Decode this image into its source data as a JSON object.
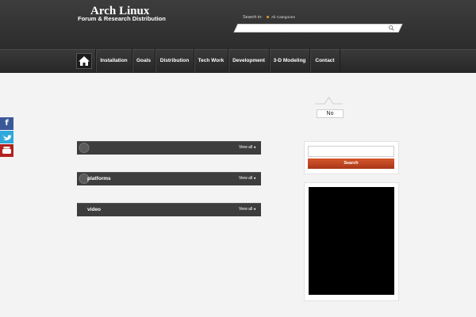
{
  "brand": {
    "title": "Arch Linux",
    "subtitle": "Forum & Research Distribution"
  },
  "search": {
    "label": "Search in:",
    "category": "All Categories",
    "placeholder": "",
    "value": ""
  },
  "nav": {
    "items": [
      {
        "label": "Installation"
      },
      {
        "label": "Goals"
      },
      {
        "label": "Distribution"
      },
      {
        "label": "Tech Work"
      },
      {
        "label": "Development"
      },
      {
        "label": "3-D Modeling"
      },
      {
        "label": "Contact"
      }
    ]
  },
  "dropdown": {
    "text": "No"
  },
  "sections": [
    {
      "title": "",
      "view_all": "View all"
    },
    {
      "title": "platforms",
      "view_all": "View all"
    },
    {
      "title": "video",
      "view_all": "View all"
    }
  ],
  "sidebar": {
    "search_button": "Search"
  },
  "social": [
    "facebook-icon",
    "twitter-icon",
    "youtube-icon"
  ],
  "colors": {
    "header_bg": "#333333",
    "search_button": "#c2481f",
    "facebook": "#3b5998",
    "twitter": "#2fa8db",
    "youtube": "#b3221f"
  }
}
